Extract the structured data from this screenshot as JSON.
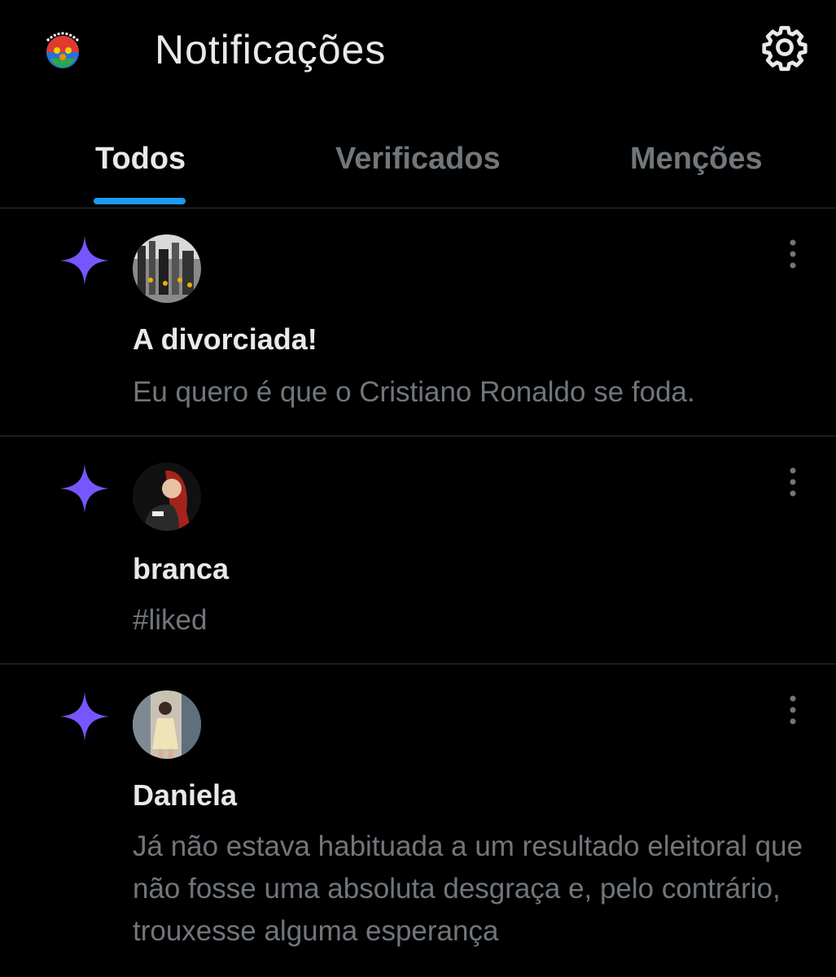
{
  "header": {
    "title": "Notificações",
    "logo_icon": "meantro-logo-icon",
    "settings_icon": "gear-icon"
  },
  "tabs": [
    {
      "label": "Todos",
      "active": true
    },
    {
      "label": "Verificados",
      "active": false
    },
    {
      "label": "Menções",
      "active": false
    }
  ],
  "colors": {
    "background": "#000000",
    "accent": "#1d9bf0",
    "sparkle": "#7856ff",
    "muted_text": "#71767b",
    "divider": "#2f3336"
  },
  "notifications": [
    {
      "icon": "sparkle-icon",
      "name": "A divorciada!",
      "text": "Eu quero é que o Cristiano Ronaldo se foda."
    },
    {
      "icon": "sparkle-icon",
      "name": "branca",
      "text": "#liked"
    },
    {
      "icon": "sparkle-icon",
      "name": "Daniela",
      "text": "Já não estava habituada a um resultado eleitoral que não fosse uma absoluta desgraça e, pelo contrário, trouxesse alguma esperança"
    }
  ]
}
